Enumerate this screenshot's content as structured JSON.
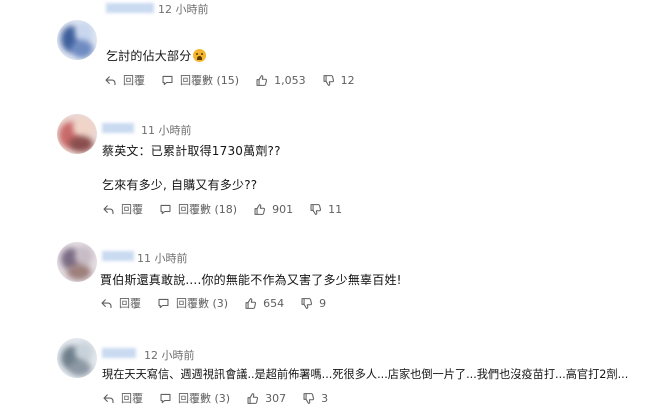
{
  "comments": [
    {
      "time": "12 小時前",
      "lines": [
        "乞討的佔大部分"
      ],
      "emoji": "crying-face",
      "reply_label": "回覆",
      "replies_label": "回覆數 (15)",
      "likes": "1,053",
      "dislikes": "12"
    },
    {
      "time": "11 小時前",
      "lines": [
        "蔡英文：已累計取得1730萬劑??",
        "乞來有多少, 自購又有多少??"
      ],
      "reply_label": "回覆",
      "replies_label": "回覆數 (18)",
      "likes": "901",
      "dislikes": "11"
    },
    {
      "time": "11 小時前",
      "lines": [
        "賈伯斯還真敢說....你的無能不作為又害了多少無辜百姓!"
      ],
      "reply_label": "回覆",
      "replies_label": "回覆數 (3)",
      "likes": "654",
      "dislikes": "9"
    },
    {
      "time": "12 小時前",
      "lines": [
        "現在天天寫信、週週視訊會議..是超前佈署嗎...死很多人...店家也倒一片了...我們也沒疫苗打...高官打2劑..."
      ],
      "reply_label": "回覆",
      "replies_label": "回覆數 (3)",
      "likes": "307",
      "dislikes": "3"
    }
  ],
  "colors": {
    "text": "#141414",
    "meta": "#6f6f6f",
    "action": "#5f5f5f"
  },
  "icons": [
    "reply-icon",
    "chat-bubble-icon",
    "thumbs-up-icon",
    "thumbs-down-icon"
  ]
}
